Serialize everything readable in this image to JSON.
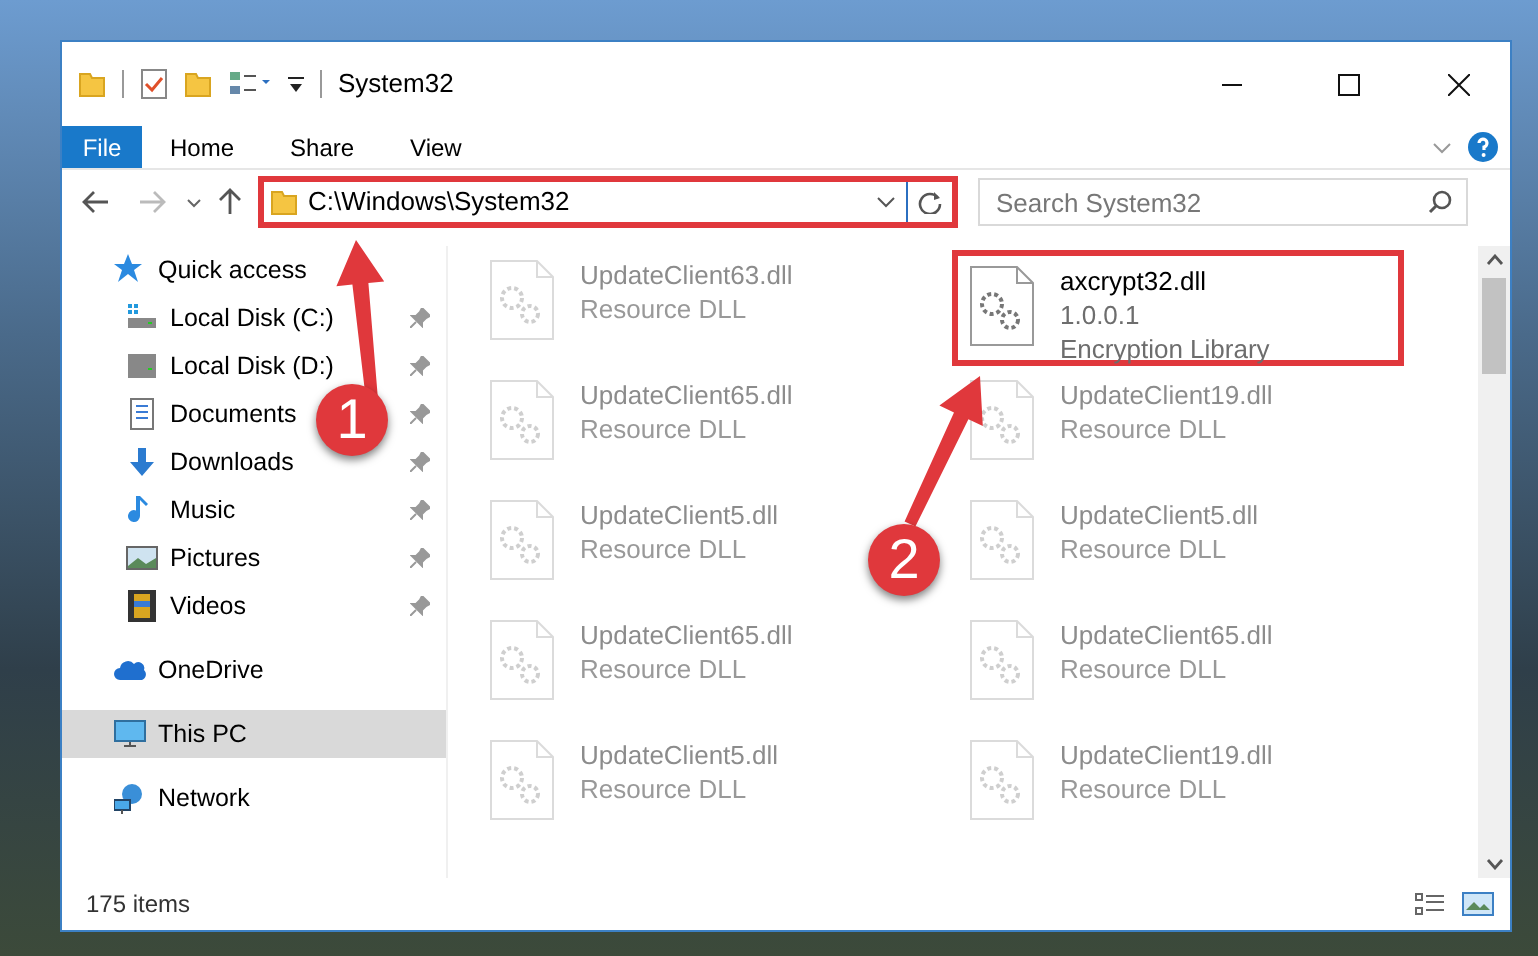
{
  "window": {
    "title": "System32"
  },
  "ribbon": {
    "file_tab": "File",
    "tabs": [
      {
        "label": "Home"
      },
      {
        "label": "Share"
      },
      {
        "label": "View"
      }
    ]
  },
  "address": {
    "path": "C:\\Windows\\System32",
    "highlighted": true
  },
  "search": {
    "placeholder": "Search System32"
  },
  "nav": [
    {
      "label": "Quick access",
      "kind": "star",
      "selected": false,
      "children": [
        {
          "label": "Local Disk (C:)",
          "kind": "drive-c",
          "pinned": true
        },
        {
          "label": "Local Disk (D:)",
          "kind": "drive",
          "pinned": true
        },
        {
          "label": "Documents",
          "kind": "document",
          "pinned": true
        },
        {
          "label": "Downloads",
          "kind": "download",
          "pinned": true
        },
        {
          "label": "Music",
          "kind": "music",
          "pinned": true
        },
        {
          "label": "Pictures",
          "kind": "picture",
          "pinned": true
        },
        {
          "label": "Videos",
          "kind": "video",
          "pinned": true
        }
      ]
    },
    {
      "label": "OneDrive",
      "kind": "cloud",
      "selected": false
    },
    {
      "label": "This PC",
      "kind": "pc",
      "selected": true
    },
    {
      "label": "Network",
      "kind": "network",
      "selected": false
    }
  ],
  "files": [
    {
      "name": "UpdateClient63.dll",
      "lines": [
        "Resource DLL"
      ],
      "dimmed": true,
      "highlighted": false
    },
    {
      "name": "axcrypt32.dll",
      "lines": [
        "1.0.0.1",
        "Encryption Library"
      ],
      "dimmed": false,
      "highlighted": true
    },
    {
      "name": "UpdateClient65.dll",
      "lines": [
        "Resource DLL"
      ],
      "dimmed": true,
      "highlighted": false
    },
    {
      "name": "UpdateClient19.dll",
      "lines": [
        "Resource DLL"
      ],
      "dimmed": true,
      "highlighted": false
    },
    {
      "name": "UpdateClient5.dll",
      "lines": [
        "Resource DLL"
      ],
      "dimmed": true,
      "highlighted": false
    },
    {
      "name": "UpdateClient5.dll",
      "lines": [
        "Resource DLL"
      ],
      "dimmed": true,
      "highlighted": false
    },
    {
      "name": "UpdateClient65.dll",
      "lines": [
        "Resource DLL"
      ],
      "dimmed": true,
      "highlighted": false
    },
    {
      "name": "UpdateClient65.dll",
      "lines": [
        "Resource DLL"
      ],
      "dimmed": true,
      "highlighted": false
    },
    {
      "name": "UpdateClient5.dll",
      "lines": [
        "Resource DLL"
      ],
      "dimmed": true,
      "highlighted": false
    },
    {
      "name": "UpdateClient19.dll",
      "lines": [
        "Resource DLL"
      ],
      "dimmed": true,
      "highlighted": false
    }
  ],
  "annotations": [
    {
      "number": "1"
    },
    {
      "number": "2"
    }
  ],
  "status_bar": {
    "count": "175 items"
  }
}
